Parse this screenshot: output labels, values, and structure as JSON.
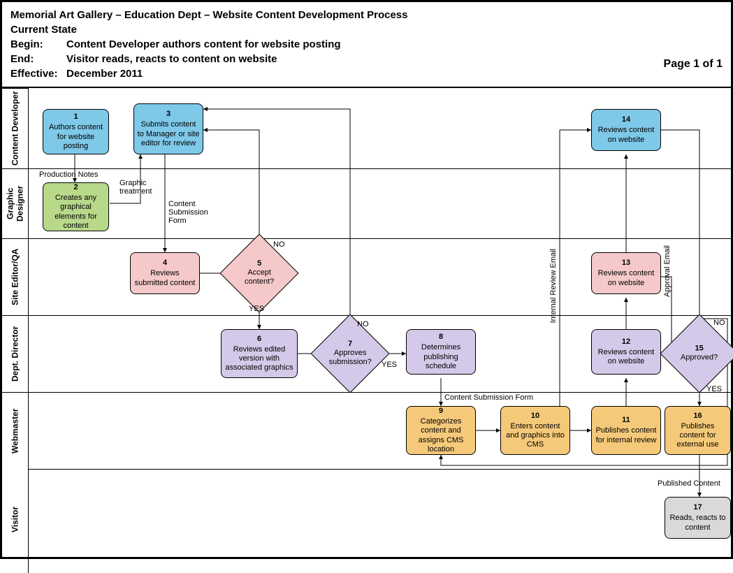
{
  "header": {
    "title": "Memorial Art Gallery – Education Dept – Website Content Development Process",
    "state": "Current State",
    "begin_label": "Begin:",
    "begin": "Content Developer authors content for website posting",
    "end_label": "End:",
    "end": "Visitor reads, reacts to content on website",
    "effective_label": "Effective:",
    "effective": "December 2011",
    "page": "Page 1 of 1"
  },
  "lanes": {
    "l1": "Content Developer",
    "l2": "Graphic Designer",
    "l3": "Site Editor/QA",
    "l4": "Dept. Director",
    "l5": "Webmaster",
    "l6": "Visitor"
  },
  "boxes": {
    "b1": {
      "n": "1",
      "t": "Authors content for website posting"
    },
    "b2": {
      "n": "2",
      "t": "Creates any graphical elements for content"
    },
    "b3": {
      "n": "3",
      "t": "Submits content to Manager or site editor for review"
    },
    "b4": {
      "n": "4",
      "t": "Reviews submitted content"
    },
    "b5": {
      "n": "5",
      "t": "Accept content?"
    },
    "b6": {
      "n": "6",
      "t": "Reviews edited version with associated graphics"
    },
    "b7": {
      "n": "7",
      "t": "Approves submission?"
    },
    "b8": {
      "n": "8",
      "t": "Determines publishing schedule"
    },
    "b9": {
      "n": "9",
      "t": "Categorizes content and assigns CMS location"
    },
    "b10": {
      "n": "10",
      "t": "Enters content and graphics into CMS"
    },
    "b11": {
      "n": "11",
      "t": "Publishes content for internal review"
    },
    "b12": {
      "n": "12",
      "t": "Reviews content on website"
    },
    "b13": {
      "n": "13",
      "t": "Reviews content on website"
    },
    "b14": {
      "n": "14",
      "t": "Reviews content on website"
    },
    "b15": {
      "n": "15",
      "t": "Approved?"
    },
    "b16": {
      "n": "16",
      "t": "Publishes content for external use"
    },
    "b17": {
      "n": "17",
      "t": "Reads, reacts to content"
    }
  },
  "labels": {
    "prodnotes": "Production Notes",
    "graphic": "Graphic treatment",
    "csf": "Content Submission Form",
    "csf2": "Content Submission Form",
    "ire": "Internal Review Email",
    "ae": "Approval Email",
    "pc": "Published Content",
    "yes": "YES",
    "no": "NO"
  }
}
